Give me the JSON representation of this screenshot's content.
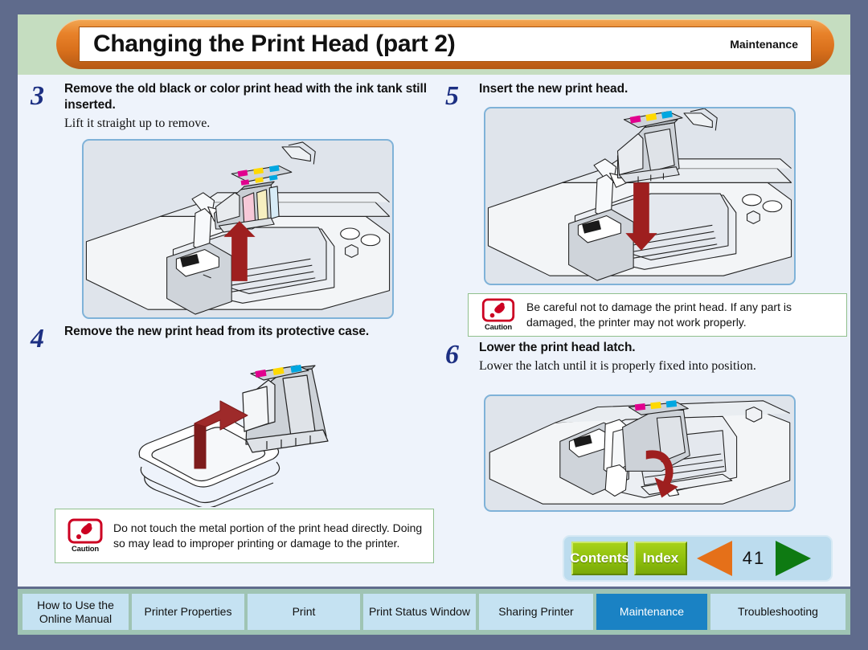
{
  "header": {
    "title": "Changing the Print Head (part 2)",
    "section": "Maintenance"
  },
  "steps": [
    {
      "number": "3",
      "title": "Remove the old black or color print head with the ink tank still inserted.",
      "subtitle": "Lift it straight up to remove.",
      "figure": "printer-carriage-print-head-lift-up"
    },
    {
      "number": "4",
      "title": "Remove the new print head from its protective case.",
      "subtitle": "",
      "figure": "print-head-removed-from-protective-case"
    },
    {
      "number": "5",
      "title": "Insert the new print head.",
      "subtitle": "",
      "figure": "printer-carriage-print-head-insert-down"
    },
    {
      "number": "6",
      "title": "Lower the print head latch.",
      "subtitle": "Lower the latch until it is properly fixed into position.",
      "figure": "printer-carriage-lower-latch"
    }
  ],
  "cautions": [
    {
      "label": "Caution",
      "text": "Do not touch the metal portion of the print head directly. Doing so may lead to improper printing or damage to the printer."
    },
    {
      "label": "Caution",
      "text": "Be careful not to damage the print head. If any part is damaged, the printer may not work properly."
    }
  ],
  "nav": {
    "contents_label": "Contents",
    "index_label": "Index",
    "prev_label": "previous-page",
    "next_label": "next-page",
    "page_number": "41"
  },
  "footer_tabs": [
    {
      "label": "How to Use the Online Manual",
      "active": false
    },
    {
      "label": "Printer Properties",
      "active": false
    },
    {
      "label": "Print",
      "active": false
    },
    {
      "label": "Print Status Window",
      "active": false
    },
    {
      "label": "Sharing Printer",
      "active": false
    },
    {
      "label": "Maintenance",
      "active": true
    },
    {
      "label": "Troubleshooting",
      "active": false
    }
  ],
  "colors": {
    "page_border": "#5f6b8c",
    "header_band": "#c5ddc0",
    "header_pill": "#e8822a",
    "content_bg": "#eef3fb",
    "figure_border": "#7fb2d8",
    "figure_bg": "#dfe4eb",
    "step_number": "#1c2f82",
    "caution_red": "#cc0022",
    "caution_border": "#8fbf8c",
    "nav_panel": "#bcdcee",
    "green_button": "#8dbf0c",
    "prev_arrow": "#e57019",
    "next_arrow": "#0e7a12",
    "footer_bg": "#9fc4b4",
    "tab_bg": "#c5e2f2",
    "tab_active_bg": "#1a82c4",
    "arrow_red": "#a02020"
  }
}
